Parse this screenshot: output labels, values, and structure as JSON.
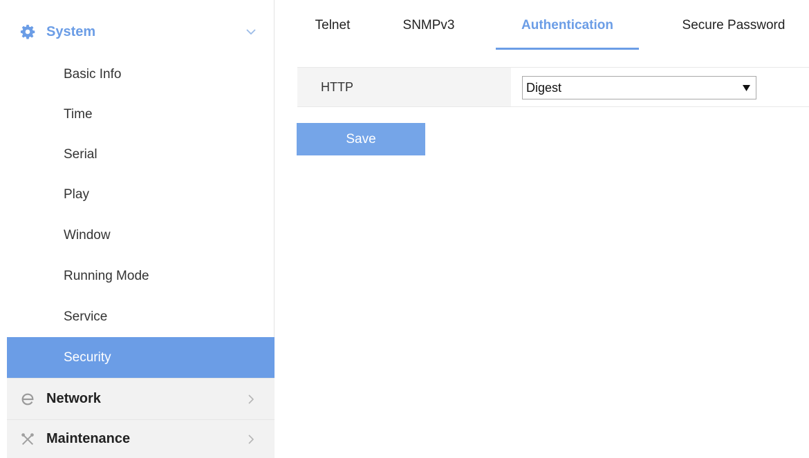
{
  "colors": {
    "accent": "#6b9de6",
    "button": "#75a5e8"
  },
  "sidebar": {
    "system": {
      "label": "System",
      "icon": "gear-icon",
      "expanded": true
    },
    "items": [
      {
        "label": "Basic Info"
      },
      {
        "label": "Time"
      },
      {
        "label": "Serial"
      },
      {
        "label": "Play"
      },
      {
        "label": "Window"
      },
      {
        "label": "Running Mode"
      },
      {
        "label": "Service"
      },
      {
        "label": "Security",
        "active": true
      }
    ],
    "network": {
      "label": "Network",
      "icon": "network-e-icon"
    },
    "maintenance": {
      "label": "Maintenance",
      "icon": "tools-icon"
    }
  },
  "tabs": [
    {
      "label": "Telnet"
    },
    {
      "label": "SNMPv3"
    },
    {
      "label": "Authentication",
      "active": true
    },
    {
      "label": "Secure Password"
    }
  ],
  "form": {
    "http_label": "HTTP",
    "http_value": "Digest"
  },
  "actions": {
    "save_label": "Save"
  }
}
